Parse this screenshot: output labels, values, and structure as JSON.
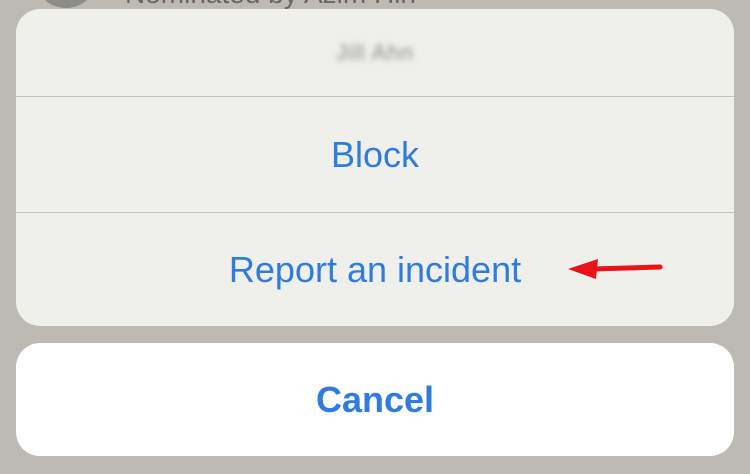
{
  "background": {
    "peek_text": "Nominated by Azim Hin"
  },
  "sheet": {
    "title": "Jill Ahn",
    "actions": [
      {
        "label": "Block"
      },
      {
        "label": "Report an incident"
      }
    ],
    "cancel_label": "Cancel"
  },
  "annotation": {
    "arrow_color": "#e8141a",
    "points_to": "Report an incident"
  },
  "colors": {
    "action_text": "#2f7bde",
    "sheet_background": "#efefeb",
    "cancel_background": "#ffffff",
    "backdrop": "#bdbab4"
  }
}
